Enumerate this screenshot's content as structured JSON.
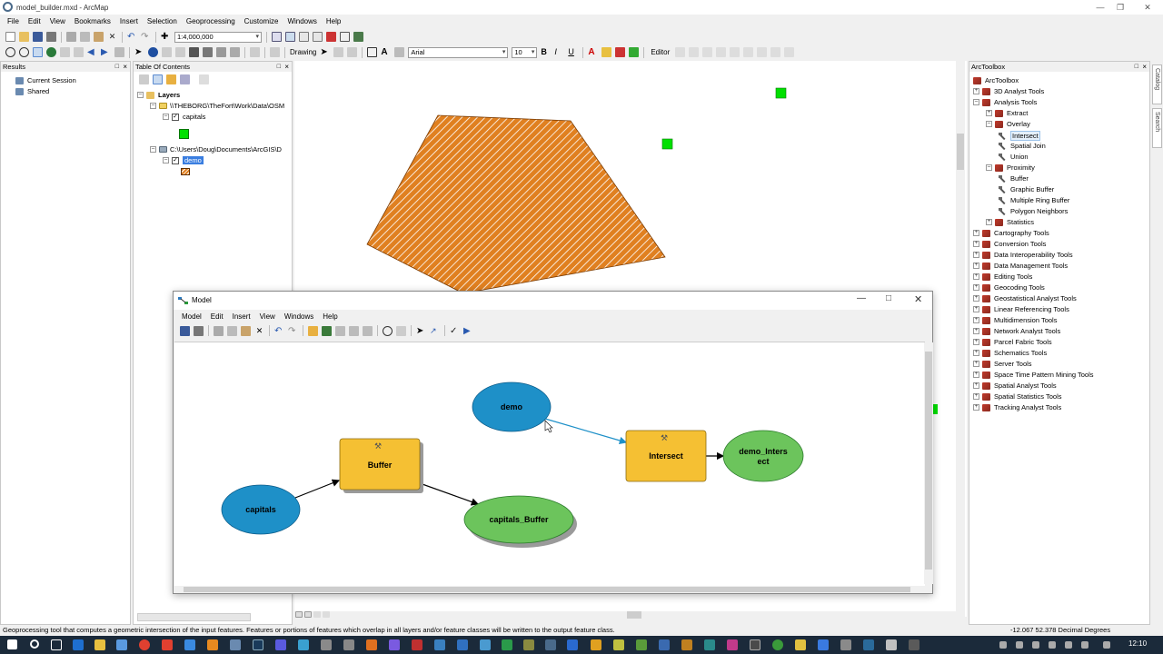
{
  "app": {
    "title": "model_builder.mxd - ArcMap"
  },
  "menu": [
    "File",
    "Edit",
    "View",
    "Bookmarks",
    "Insert",
    "Selection",
    "Geoprocessing",
    "Customize",
    "Windows",
    "Help"
  ],
  "toolbar": {
    "scale": "1:4,000,000",
    "drawing_label": "Drawing",
    "font_name": "Arial",
    "font_size": "10",
    "editor_label": "Editor"
  },
  "results": {
    "title": "Results",
    "items": [
      "Current Session",
      "Shared"
    ]
  },
  "toc": {
    "title": "Table Of Contents",
    "layers_label": "Layers",
    "group1": "\\\\THEBORG\\TheFort\\Work\\Data\\OSM",
    "layer1": "capitals",
    "group2": "C:\\Users\\Doug\\Documents\\ArcGIS\\D",
    "layer2": "demo"
  },
  "arctoolbox": {
    "title": "ArcToolbox",
    "root": "ArcToolbox",
    "items": [
      {
        "label": "3D Analyst Tools",
        "level": 1,
        "kind": "box",
        "exp": "+"
      },
      {
        "label": "Analysis Tools",
        "level": 1,
        "kind": "box",
        "exp": "-"
      },
      {
        "label": "Extract",
        "level": 2,
        "kind": "box",
        "exp": "+"
      },
      {
        "label": "Overlay",
        "level": 2,
        "kind": "box",
        "exp": "-"
      },
      {
        "label": "Intersect",
        "level": 3,
        "kind": "tool",
        "selected": true
      },
      {
        "label": "Spatial Join",
        "level": 3,
        "kind": "tool"
      },
      {
        "label": "Union",
        "level": 3,
        "kind": "tool"
      },
      {
        "label": "Proximity",
        "level": 2,
        "kind": "box",
        "exp": "-"
      },
      {
        "label": "Buffer",
        "level": 3,
        "kind": "tool"
      },
      {
        "label": "Graphic Buffer",
        "level": 3,
        "kind": "tool"
      },
      {
        "label": "Multiple Ring Buffer",
        "level": 3,
        "kind": "tool"
      },
      {
        "label": "Polygon Neighbors",
        "level": 3,
        "kind": "tool"
      },
      {
        "label": "Statistics",
        "level": 2,
        "kind": "box",
        "exp": "+"
      },
      {
        "label": "Cartography Tools",
        "level": 1,
        "kind": "box",
        "exp": "+"
      },
      {
        "label": "Conversion Tools",
        "level": 1,
        "kind": "box",
        "exp": "+"
      },
      {
        "label": "Data Interoperability Tools",
        "level": 1,
        "kind": "box",
        "exp": "+"
      },
      {
        "label": "Data Management Tools",
        "level": 1,
        "kind": "box",
        "exp": "+"
      },
      {
        "label": "Editing Tools",
        "level": 1,
        "kind": "box",
        "exp": "+"
      },
      {
        "label": "Geocoding Tools",
        "level": 1,
        "kind": "box",
        "exp": "+"
      },
      {
        "label": "Geostatistical Analyst Tools",
        "level": 1,
        "kind": "box",
        "exp": "+"
      },
      {
        "label": "Linear Referencing Tools",
        "level": 1,
        "kind": "box",
        "exp": "+"
      },
      {
        "label": "Multidimension Tools",
        "level": 1,
        "kind": "box",
        "exp": "+"
      },
      {
        "label": "Network Analyst Tools",
        "level": 1,
        "kind": "box",
        "exp": "+"
      },
      {
        "label": "Parcel Fabric Tools",
        "level": 1,
        "kind": "box",
        "exp": "+"
      },
      {
        "label": "Schematics Tools",
        "level": 1,
        "kind": "box",
        "exp": "+"
      },
      {
        "label": "Server Tools",
        "level": 1,
        "kind": "box",
        "exp": "+"
      },
      {
        "label": "Space Time Pattern Mining Tools",
        "level": 1,
        "kind": "box",
        "exp": "+"
      },
      {
        "label": "Spatial Analyst Tools",
        "level": 1,
        "kind": "box",
        "exp": "+"
      },
      {
        "label": "Spatial Statistics Tools",
        "level": 1,
        "kind": "box",
        "exp": "+"
      },
      {
        "label": "Tracking Analyst Tools",
        "level": 1,
        "kind": "box",
        "exp": "+"
      }
    ]
  },
  "side_tabs": [
    "Catalog",
    "Search"
  ],
  "model": {
    "title": "Model",
    "menu": [
      "Model",
      "Edit",
      "Insert",
      "View",
      "Windows",
      "Help"
    ],
    "nodes": {
      "demo": "demo",
      "capitals": "capitals",
      "buffer": "Buffer",
      "capitals_buffer": "capitals_Buffer",
      "intersect": "Intersect",
      "demo_intersect_1": "demo_Inters",
      "demo_intersect_2": "ect"
    },
    "colors": {
      "input": "#1e90c8",
      "tool": "#f5c033",
      "output": "#6cc45c"
    }
  },
  "status": {
    "message": "Geoprocessing tool that computes a geometric intersection of the input features. Features or portions of features which overlap in all layers and/or feature classes will be written to the output feature class.",
    "coords": "-12.067  52.378 Decimal Degrees"
  },
  "taskbar": {
    "time": "12:10"
  }
}
